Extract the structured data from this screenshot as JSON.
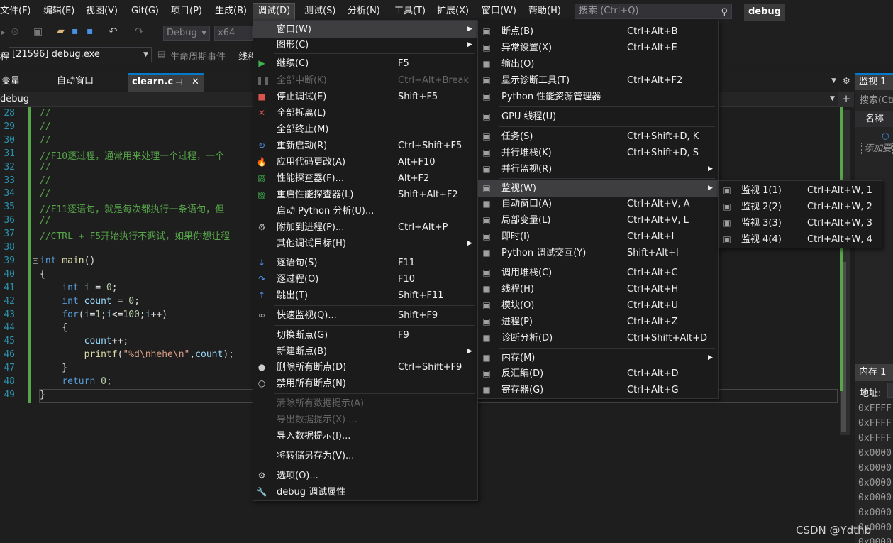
{
  "menubar": {
    "items": [
      "文件(F)",
      "编辑(E)",
      "视图(V)",
      "Git(G)",
      "项目(P)",
      "生成(B)",
      "调试(D)",
      "测试(S)",
      "分析(N)",
      "工具(T)",
      "扩展(X)",
      "窗口(W)",
      "帮助(H)"
    ],
    "search_placeholder": "搜索 (Ctrl+Q)",
    "solution_name": "debug"
  },
  "toolbar": {
    "config": "Debug",
    "platform": "x64",
    "process_label": "程:",
    "process": "[21596] debug.exe",
    "lifecycle": "生命周期事件",
    "thread_label": "线程"
  },
  "tabs": {
    "items": [
      "变量",
      "自动窗口"
    ],
    "active": "clearn.c",
    "pin_icon": "⊣",
    "close_icon": "✕"
  },
  "navbar": {
    "scope": "debug"
  },
  "editor": {
    "lines": [
      {
        "n": "28",
        "text": "//"
      },
      {
        "n": "29",
        "text": "//"
      },
      {
        "n": "30",
        "text": "//"
      },
      {
        "n": "31",
        "text": "//F10逐过程，通常用来处理一个过程，一个"
      },
      {
        "n": "32",
        "text": "//"
      },
      {
        "n": "33",
        "text": "//"
      },
      {
        "n": "34",
        "text": "//"
      },
      {
        "n": "35",
        "text": "//F11逐语句，就是每次都执行一条语句，但"
      },
      {
        "n": "36",
        "text": "//"
      },
      {
        "n": "37",
        "text": "//CTRL + F5开始执行不调试，如果你想让程"
      },
      {
        "n": "38",
        "text": ""
      },
      {
        "n": "39",
        "text": "int main()"
      },
      {
        "n": "40",
        "text": "{"
      },
      {
        "n": "41",
        "text": "    int i = 0;"
      },
      {
        "n": "42",
        "text": "    int count = 0;"
      },
      {
        "n": "43",
        "text": "    for(i=1;i<=100;i++)"
      },
      {
        "n": "44",
        "text": "    {"
      },
      {
        "n": "45",
        "text": "        count++;"
      },
      {
        "n": "46",
        "text": "        printf(\"%d\\nhehe\\n\",count);"
      },
      {
        "n": "47",
        "text": "    }"
      },
      {
        "n": "48",
        "text": "    return 0;"
      },
      {
        "n": "49",
        "text": "}"
      }
    ]
  },
  "debug_menu": {
    "items": [
      {
        "label": "窗口(W)",
        "shortcut": "",
        "submenu": true,
        "highlight": true
      },
      {
        "label": "图形(C)",
        "shortcut": "",
        "submenu": true
      },
      {
        "label": "继续(C)",
        "shortcut": "F5",
        "icon": "continue-icon"
      },
      {
        "label": "全部中断(K)",
        "shortcut": "Ctrl+Alt+Break",
        "disabled": true,
        "icon": "pause-icon"
      },
      {
        "label": "停止调试(E)",
        "shortcut": "Shift+F5",
        "icon": "stop-icon"
      },
      {
        "label": "全部拆离(L)",
        "shortcut": "",
        "icon": "detach-icon"
      },
      {
        "label": "全部终止(M)",
        "shortcut": ""
      },
      {
        "label": "重新启动(R)",
        "shortcut": "Ctrl+Shift+F5",
        "icon": "restart-icon"
      },
      {
        "label": "应用代码更改(A)",
        "shortcut": "Alt+F10",
        "icon": "hot-reload-icon"
      },
      {
        "label": "性能探查器(F)...",
        "shortcut": "Alt+F2",
        "icon": "profiler-icon"
      },
      {
        "label": "重启性能探查器(L)",
        "shortcut": "Shift+Alt+F2",
        "icon": "profiler-restart-icon"
      },
      {
        "label": "启动 Python 分析(U)...",
        "shortcut": ""
      },
      {
        "label": "附加到进程(P)...",
        "shortcut": "Ctrl+Alt+P",
        "icon": "attach-icon"
      },
      {
        "label": "其他调试目标(H)",
        "shortcut": "",
        "submenu": true
      },
      {
        "label": "逐语句(S)",
        "shortcut": "F11",
        "icon": "step-into-icon"
      },
      {
        "label": "逐过程(O)",
        "shortcut": "F10",
        "icon": "step-over-icon"
      },
      {
        "label": "跳出(T)",
        "shortcut": "Shift+F11",
        "icon": "step-out-icon"
      },
      {
        "label": "快速监视(Q)...",
        "shortcut": "Shift+F9",
        "icon": "quickwatch-icon"
      },
      {
        "label": "切换断点(G)",
        "shortcut": "F9"
      },
      {
        "label": "新建断点(B)",
        "shortcut": "",
        "submenu": true
      },
      {
        "label": "删除所有断点(D)",
        "shortcut": "Ctrl+Shift+F9",
        "icon": "delete-breakpoints-icon"
      },
      {
        "label": "禁用所有断点(N)",
        "shortcut": "",
        "icon": "disable-breakpoints-icon"
      },
      {
        "label": "清除所有数据提示(A)",
        "shortcut": "",
        "disabled": true
      },
      {
        "label": "导出数据提示(X) ...",
        "shortcut": "",
        "disabled": true
      },
      {
        "label": "导入数据提示(I)...",
        "shortcut": ""
      },
      {
        "label": "将转储另存为(V)...",
        "shortcut": ""
      },
      {
        "label": "选项(O)...",
        "shortcut": "",
        "icon": "gear-icon"
      },
      {
        "label": "debug 调试属性",
        "shortcut": "",
        "icon": "wrench-icon"
      }
    ]
  },
  "window_submenu": {
    "items": [
      {
        "label": "断点(B)",
        "shortcut": "Ctrl+Alt+B"
      },
      {
        "label": "异常设置(X)",
        "shortcut": "Ctrl+Alt+E"
      },
      {
        "label": "输出(O)",
        "shortcut": ""
      },
      {
        "label": "显示诊断工具(T)",
        "shortcut": "Ctrl+Alt+F2"
      },
      {
        "label": "Python 性能资源管理器",
        "shortcut": ""
      },
      {
        "label": "GPU 线程(U)",
        "shortcut": ""
      },
      {
        "label": "任务(S)",
        "shortcut": "Ctrl+Shift+D, K"
      },
      {
        "label": "并行堆栈(K)",
        "shortcut": "Ctrl+Shift+D, S"
      },
      {
        "label": "并行监视(R)",
        "shortcut": "",
        "submenu": true
      },
      {
        "label": "监视(W)",
        "shortcut": "",
        "submenu": true,
        "highlight": true
      },
      {
        "label": "自动窗口(A)",
        "shortcut": "Ctrl+Alt+V, A"
      },
      {
        "label": "局部变量(L)",
        "shortcut": "Ctrl+Alt+V, L"
      },
      {
        "label": "即时(I)",
        "shortcut": "Ctrl+Alt+I"
      },
      {
        "label": "Python 调试交互(Y)",
        "shortcut": "Shift+Alt+I"
      },
      {
        "label": "调用堆栈(C)",
        "shortcut": "Ctrl+Alt+C"
      },
      {
        "label": "线程(H)",
        "shortcut": "Ctrl+Alt+H"
      },
      {
        "label": "模块(O)",
        "shortcut": "Ctrl+Alt+U"
      },
      {
        "label": "进程(P)",
        "shortcut": "Ctrl+Alt+Z"
      },
      {
        "label": "诊断分析(D)",
        "shortcut": "Ctrl+Shift+Alt+D"
      },
      {
        "label": "内存(M)",
        "shortcut": "",
        "submenu": true
      },
      {
        "label": "反汇编(D)",
        "shortcut": "Ctrl+Alt+D"
      },
      {
        "label": "寄存器(G)",
        "shortcut": "Ctrl+Alt+G"
      }
    ]
  },
  "watch_submenu": {
    "items": [
      {
        "label": "监视 1(1)",
        "shortcut": "Ctrl+Alt+W, 1"
      },
      {
        "label": "监视 2(2)",
        "shortcut": "Ctrl+Alt+W, 2"
      },
      {
        "label": "监视 3(3)",
        "shortcut": "Ctrl+Alt+W, 3"
      },
      {
        "label": "监视 4(4)",
        "shortcut": "Ctrl+Alt+W, 4"
      }
    ]
  },
  "right_panel": {
    "watch_title": "监视 1",
    "search": "搜索(Ctr",
    "name_col": "名称",
    "add_watch": "添加要",
    "memory_title": "内存 1",
    "address_label": "地址:",
    "address_values": [
      "0xFFFF",
      "0xFFFF",
      "0xFFFF",
      "0x0000",
      "0x0000",
      "0x0000",
      "0x0000",
      "0x0000",
      "0x0000",
      "0x0000"
    ]
  },
  "watermark": "CSDN @Ydthb",
  "colors": {
    "accent": "#007acc",
    "menu_bg": "#1b1b1c",
    "highlight": "#3e3e40",
    "comment": "#57a64a",
    "keyword": "#569cd6"
  }
}
